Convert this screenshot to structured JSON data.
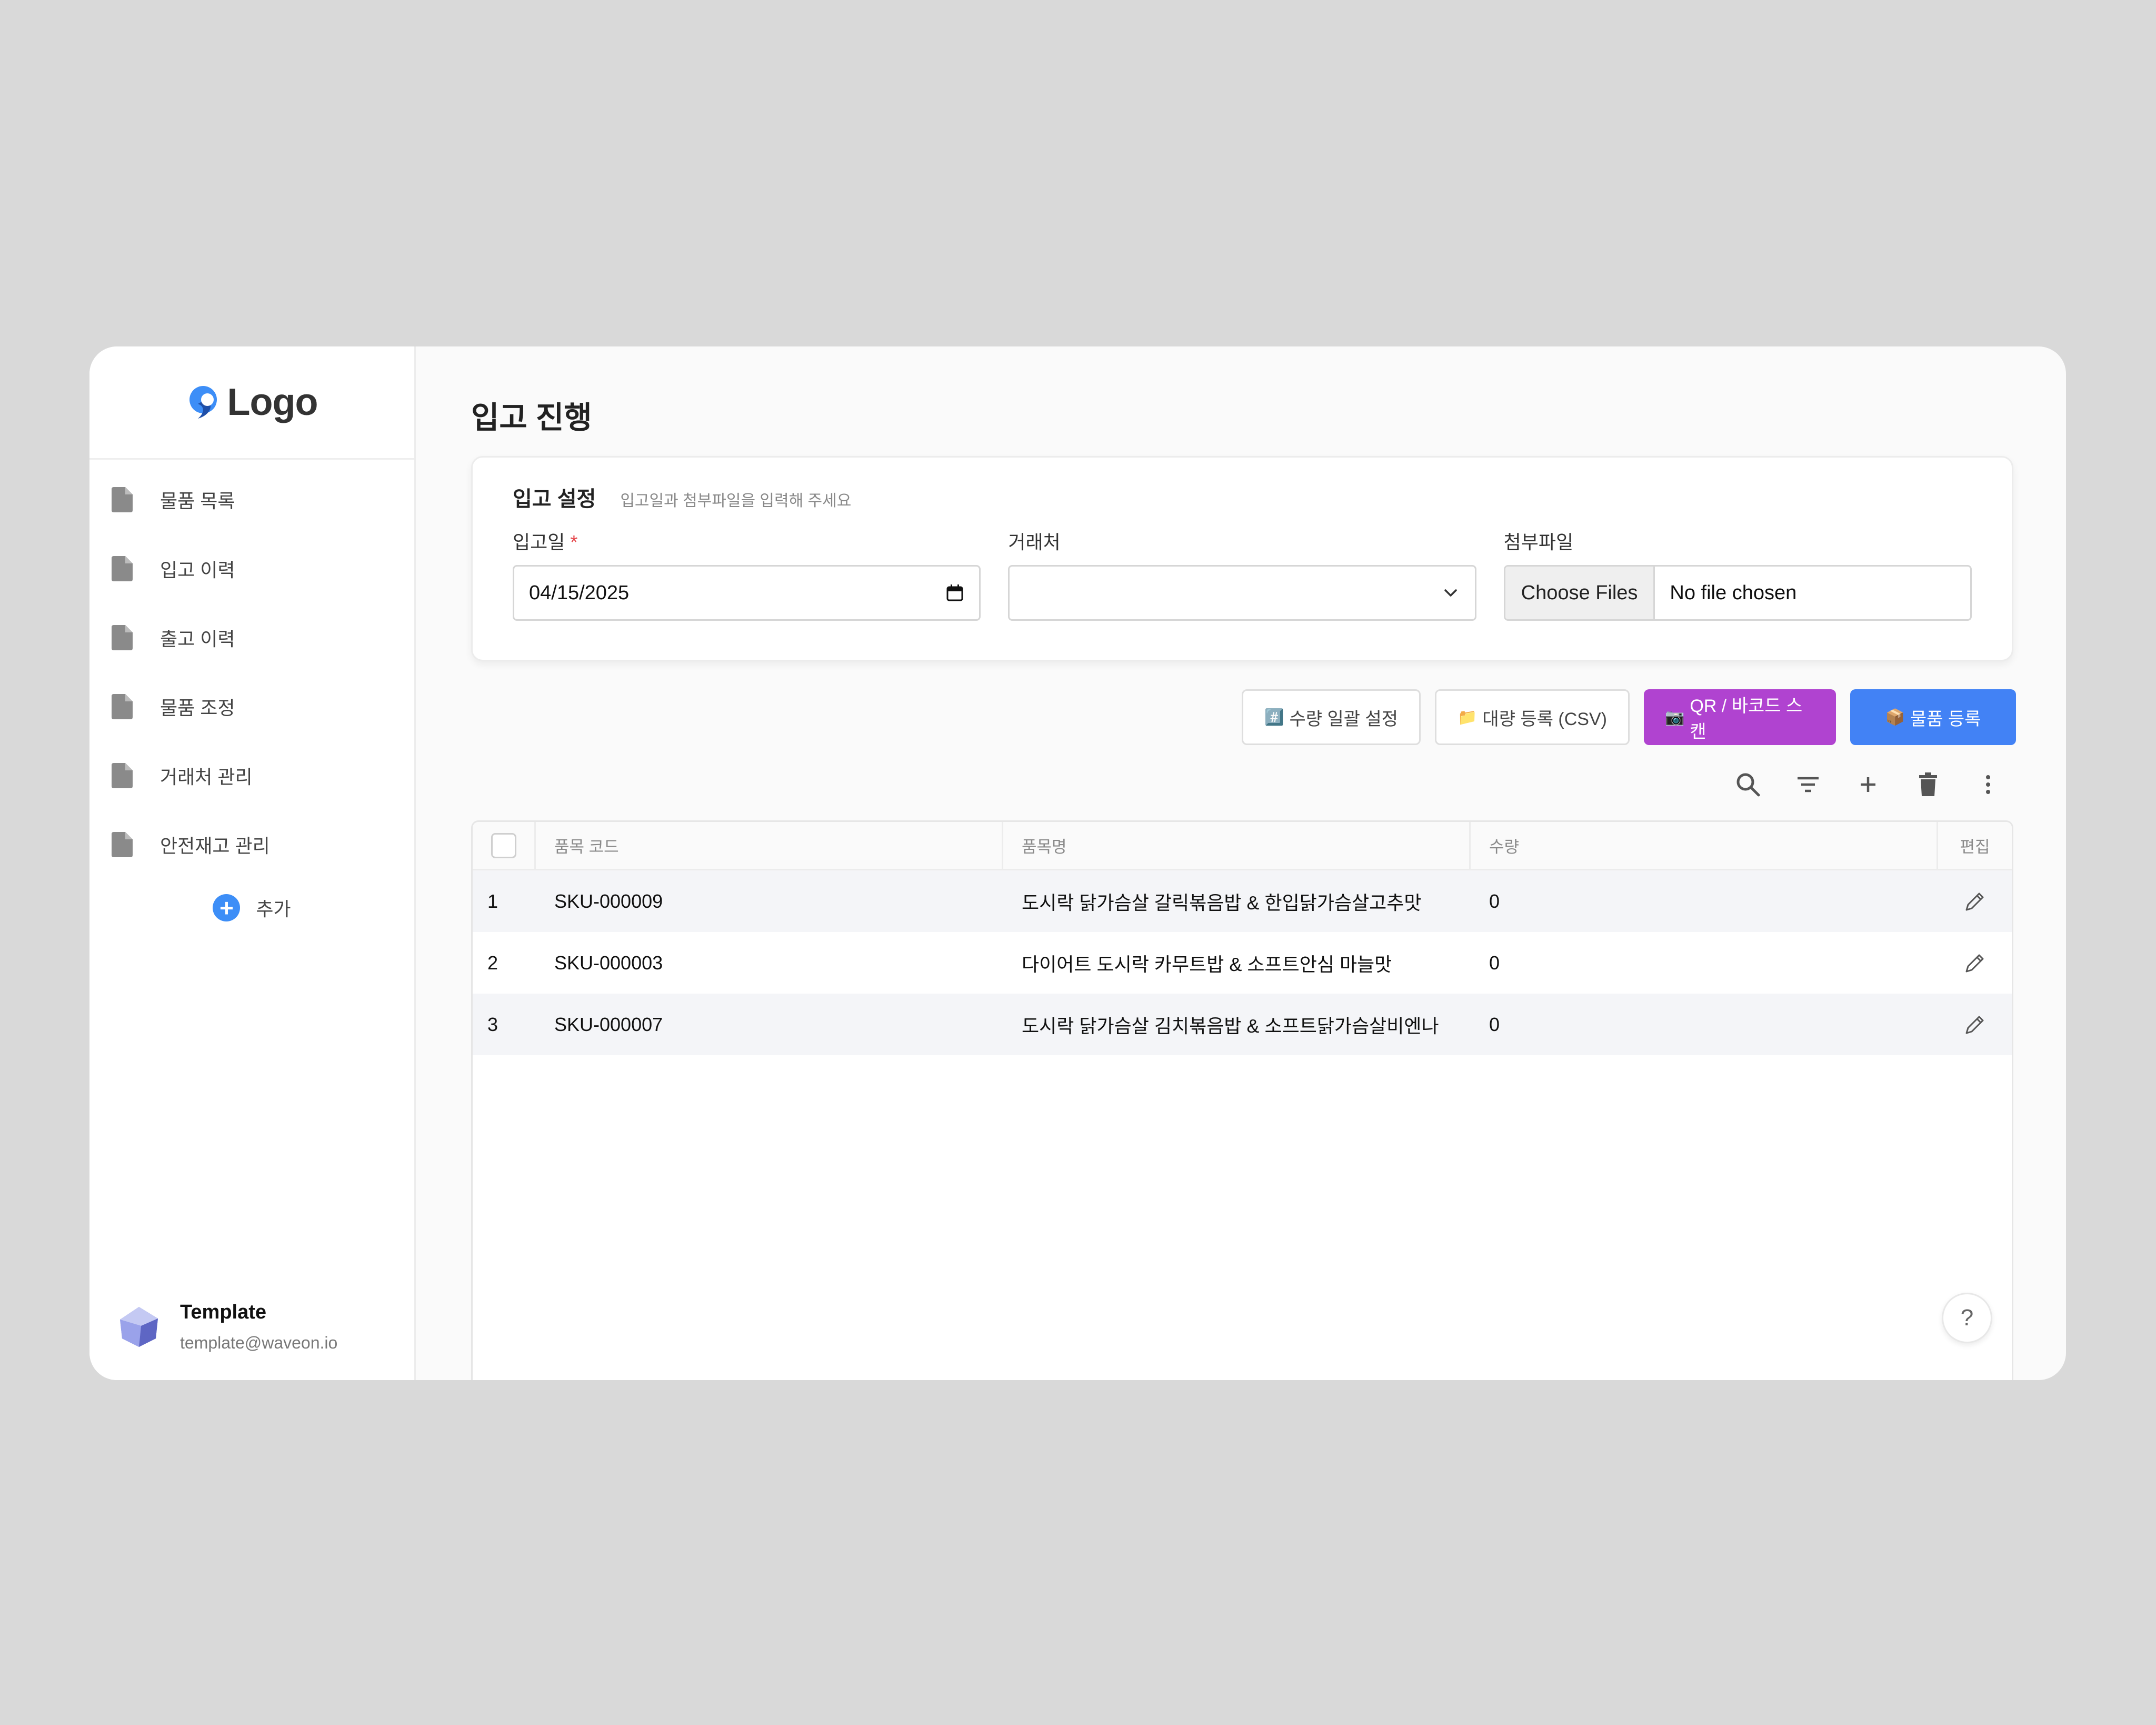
{
  "brand": {
    "logo_text": "Logo"
  },
  "sidebar": {
    "items": [
      {
        "label": "물품 목록"
      },
      {
        "label": "입고 이력"
      },
      {
        "label": "출고 이력"
      },
      {
        "label": "물품 조정"
      },
      {
        "label": "거래처 관리"
      },
      {
        "label": "안전재고 관리"
      }
    ],
    "add_label": "추가"
  },
  "profile": {
    "name": "Template",
    "email": "template@waveon.io"
  },
  "page": {
    "title": "입고 진행"
  },
  "settings": {
    "title": "입고 설정",
    "subtitle": "입고일과 첨부파일을 입력해 주세요",
    "date_label": "입고일",
    "required_mark": "*",
    "date_value": "04/15/2025",
    "vendor_label": "거래처",
    "vendor_value": "",
    "attach_label": "첨부파일",
    "file_button": "Choose Files",
    "file_status": "No file chosen"
  },
  "actions": {
    "bulk_qty": "수량 일괄 설정",
    "bulk_qty_emoji": "#️⃣",
    "bulk_csv": "대량 등록 (CSV)",
    "bulk_csv_emoji": "📁",
    "scan": "QR / 바코드 스캔",
    "scan_emoji": "📷",
    "register": "물품 등록",
    "register_emoji": "📦"
  },
  "toolbar_icons": [
    "search-icon",
    "filter-icon",
    "plus-icon",
    "trash-icon",
    "more-vertical-icon"
  ],
  "table": {
    "headers": {
      "code": "품목 코드",
      "name": "품목명",
      "qty": "수량",
      "edit": "편집"
    },
    "rows": [
      {
        "no": "1",
        "code": "SKU-000009",
        "name": "도시락 닭가슴살 갈릭볶음밥 & 한입닭가슴살고추맛",
        "qty": "0"
      },
      {
        "no": "2",
        "code": "SKU-000003",
        "name": "다이어트 도시락 카무트밥 & 소프트안심 마늘맛",
        "qty": "0"
      },
      {
        "no": "3",
        "code": "SKU-000007",
        "name": "도시락 닭가슴살 김치볶음밥 & 소프트닭가슴살비엔나",
        "qty": "0"
      }
    ]
  },
  "help": {
    "label": "?"
  },
  "colors": {
    "accent_blue": "#4282f5",
    "accent_purple": "#b043d0",
    "required_red": "#e5484d"
  }
}
